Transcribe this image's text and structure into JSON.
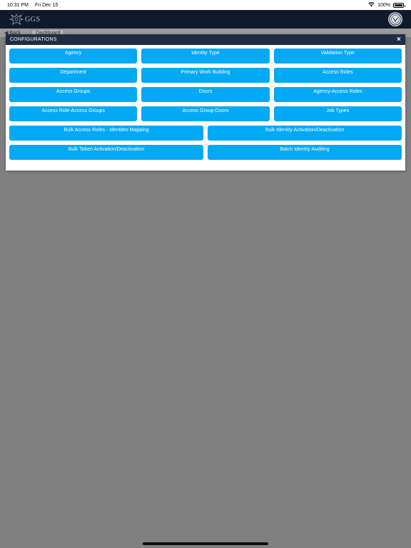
{
  "status_bar": {
    "time": "10:31 PM",
    "date": "Fri Dec 15",
    "battery": "100%",
    "battery_level": 1.0
  },
  "app_header": {
    "logo_text": "GGS"
  },
  "breadcrumb": {
    "back_label": "◀ Back",
    "tab_label": "Dashboard"
  },
  "modal": {
    "title": "CONFIGURATIONS",
    "close_label": "×",
    "accent_color": "#03a9f4",
    "header_color": "#1f2d44",
    "rows": [
      [
        "Agency",
        "Identity Type",
        "Validation Type"
      ],
      [
        "Department",
        "Primary Work Building",
        "Access Roles"
      ],
      [
        "Access Groups",
        "Doors",
        "Agency-Access Roles"
      ],
      [
        "Access Role-Access Groups",
        "Access Group-Doors",
        "Job Types"
      ],
      [
        "Bulk Access Roles - Identites Mapping",
        "Bulk Identity Activation/Deactivation"
      ],
      [
        "Bulk Token Activation/Deactivation",
        "Batch Identity Auditing"
      ]
    ]
  }
}
